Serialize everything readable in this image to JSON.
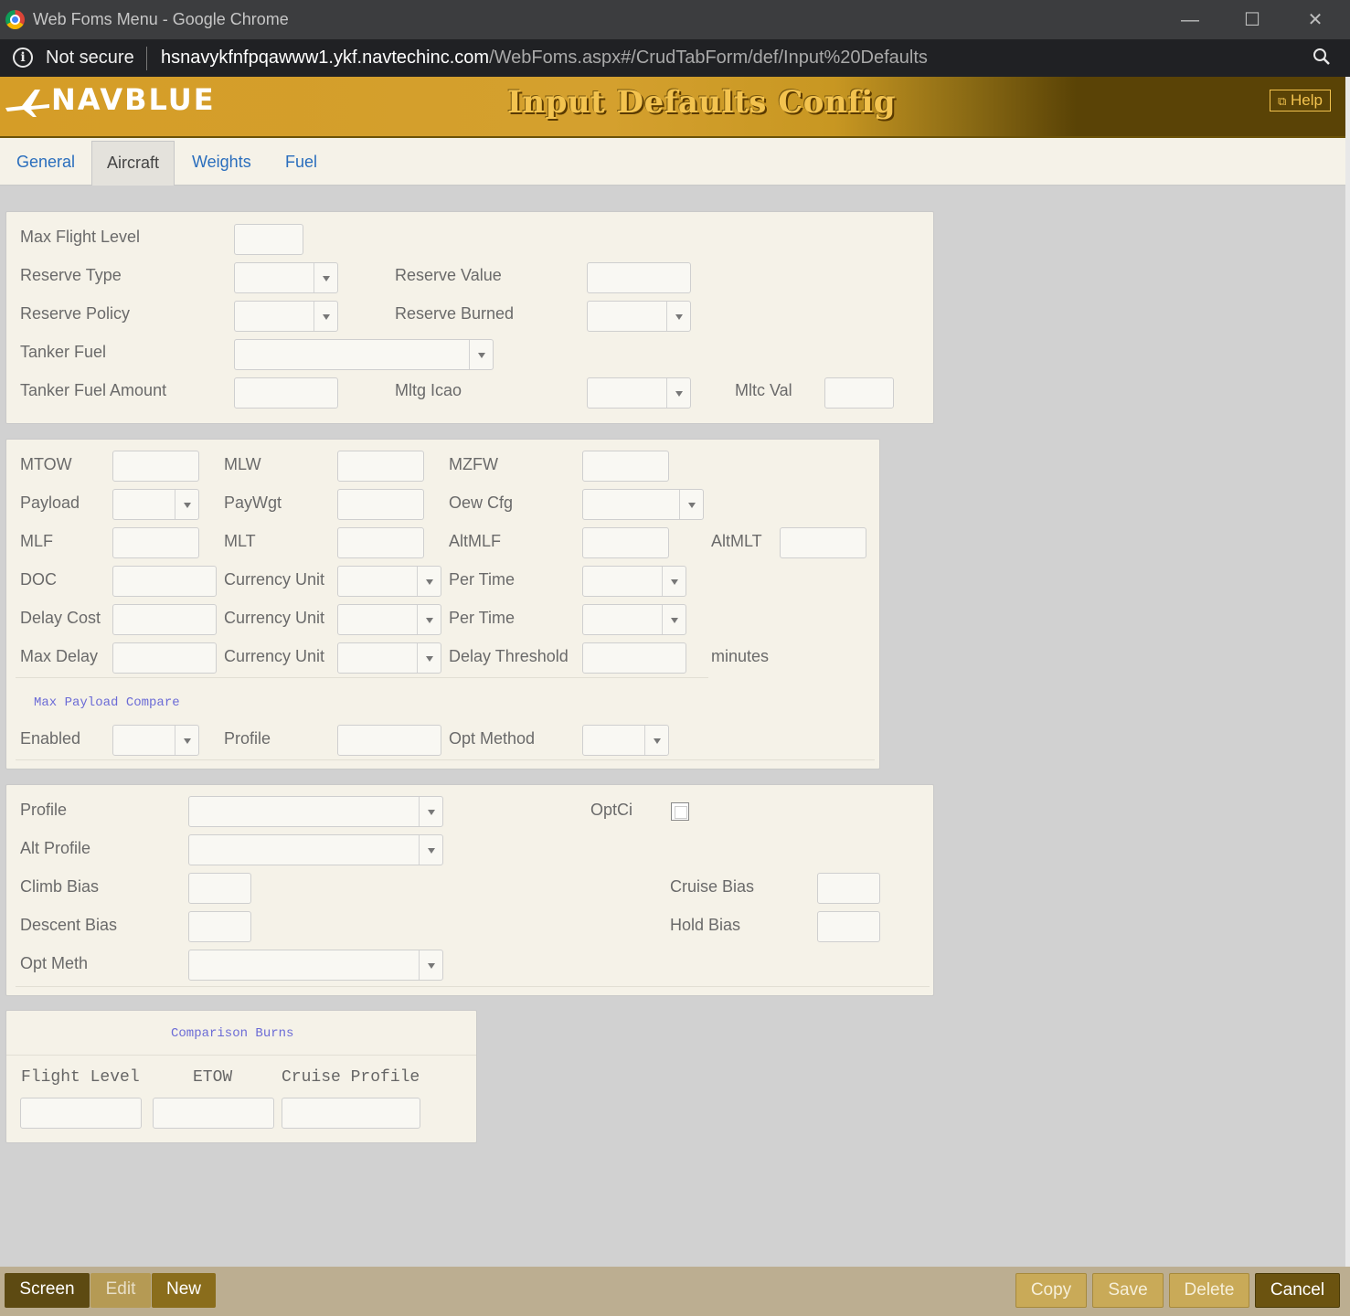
{
  "window": {
    "title": "Web Foms Menu - Google Chrome",
    "minimize_glyph": "—",
    "maximize_glyph": "☐",
    "close_glyph": "✕"
  },
  "address_bar": {
    "security_text": "Not secure",
    "host": "hsnavykfnfpqawww1.ykf.navtechinc.com",
    "path": "/WebFoms.aspx#/CrudTabForm/def/Input%20Defaults"
  },
  "header": {
    "logo_text": "NAVBLUE",
    "title": "Input Defaults Config",
    "help_label": "Help"
  },
  "tabs": [
    {
      "label": "General"
    },
    {
      "label": "Aircraft"
    },
    {
      "label": "Weights"
    },
    {
      "label": "Fuel"
    }
  ],
  "panel1": {
    "max_flight_level": "Max Flight Level",
    "reserve_type": "Reserve Type",
    "reserve_value": "Reserve Value",
    "reserve_policy": "Reserve Policy",
    "reserve_burned": "Reserve Burned",
    "tanker_fuel": "Tanker Fuel",
    "tanker_fuel_amount": "Tanker Fuel Amount",
    "mltg_icao": "Mltg Icao",
    "mltc_val": "Mltc Val"
  },
  "panel2": {
    "mtow": "MTOW",
    "mlw": "MLW",
    "mzfw": "MZFW",
    "payload": "Payload",
    "paywgt": "PayWgt",
    "oew_cfg": "Oew Cfg",
    "mlf": "MLF",
    "mlt": "MLT",
    "altmlf": "AltMLF",
    "altmlt": "AltMLT",
    "doc": "DOC",
    "currency_unit": "Currency Unit",
    "per_time": "Per Time",
    "delay_cost": "Delay Cost",
    "max_delay": "Max Delay",
    "delay_threshold": "Delay Threshold",
    "minutes": "minutes",
    "max_payload_compare": "Max Payload Compare",
    "enabled": "Enabled",
    "profile": "Profile",
    "opt_method": "Opt Method"
  },
  "panel3": {
    "profile": "Profile",
    "optci": "OptCi",
    "alt_profile": "Alt Profile",
    "climb_bias": "Climb Bias",
    "cruise_bias": "Cruise Bias",
    "descent_bias": "Descent Bias",
    "hold_bias": "Hold Bias",
    "opt_meth": "Opt Meth"
  },
  "panel4": {
    "title": "Comparison Burns",
    "flight_level": "Flight Level",
    "etow": "ETOW",
    "cruise_profile": "Cruise Profile"
  },
  "bottom": {
    "screen": "Screen",
    "edit": "Edit",
    "new": "New",
    "copy": "Copy",
    "save": "Save",
    "delete": "Delete",
    "cancel": "Cancel"
  },
  "colors": {
    "banner_gold": "#d59d27",
    "banner_dark": "#5a4306",
    "tab_link": "#2a6ebd",
    "panel_bg": "#f5f2e8",
    "page_bg": "#d1d1d1"
  }
}
